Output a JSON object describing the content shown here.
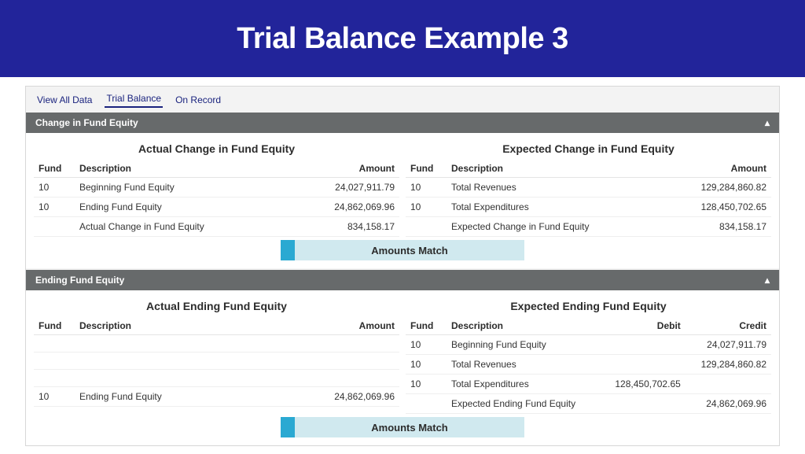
{
  "hero": {
    "title": "Trial Balance Example 3"
  },
  "tabs": {
    "items": [
      {
        "label": "View All Data"
      },
      {
        "label": "Trial Balance"
      },
      {
        "label": "On Record"
      }
    ]
  },
  "headers": {
    "fund": "Fund",
    "description": "Description",
    "amount": "Amount",
    "debit": "Debit",
    "credit": "Credit"
  },
  "sections": {
    "change": {
      "title": "Change in Fund Equity",
      "actual": {
        "title": "Actual Change in Fund Equity",
        "rows": [
          {
            "fund": "10",
            "desc": "Beginning Fund Equity",
            "amount": "24,027,911.79"
          },
          {
            "fund": "10",
            "desc": "Ending Fund Equity",
            "amount": "24,862,069.96"
          },
          {
            "fund": "",
            "desc": "Actual Change in Fund Equity",
            "amount": "834,158.17"
          }
        ]
      },
      "expected": {
        "title": "Expected Change in Fund Equity",
        "rows": [
          {
            "fund": "10",
            "desc": "Total Revenues",
            "amount": "129,284,860.82"
          },
          {
            "fund": "10",
            "desc": "Total Expenditures",
            "amount": "128,450,702.65"
          },
          {
            "fund": "",
            "desc": "Expected Change in Fund Equity",
            "amount": "834,158.17"
          }
        ]
      },
      "match": "Amounts Match"
    },
    "ending": {
      "title": "Ending Fund Equity",
      "actual": {
        "title": "Actual Ending Fund Equity",
        "rows": [
          {
            "fund": "10",
            "desc": "Ending Fund Equity",
            "amount": "24,862,069.96"
          }
        ]
      },
      "expected": {
        "title": "Expected Ending Fund Equity",
        "rows": [
          {
            "fund": "10",
            "desc": "Beginning Fund Equity",
            "debit": "",
            "credit": "24,027,911.79"
          },
          {
            "fund": "10",
            "desc": "Total Revenues",
            "debit": "",
            "credit": "129,284,860.82"
          },
          {
            "fund": "10",
            "desc": "Total Expenditures",
            "debit": "128,450,702.65",
            "credit": ""
          },
          {
            "fund": "",
            "desc": "Expected Ending Fund Equity",
            "debit": "",
            "credit": "24,862,069.96"
          }
        ]
      },
      "match": "Amounts Match"
    }
  }
}
